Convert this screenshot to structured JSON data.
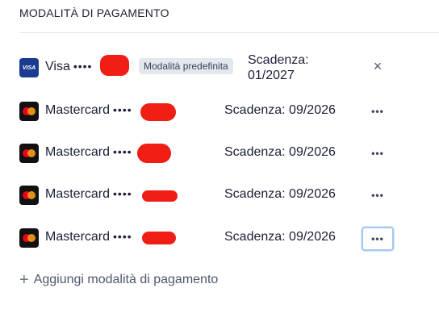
{
  "section": {
    "title": "MODALITÀ DI PAGAMENTO"
  },
  "cards": [
    {
      "brand_icon": "visa-logo-icon",
      "brand_short": "VISA",
      "brand": "Visa",
      "masked": "••••",
      "badge": "Modalità predefinita",
      "expiry": "Scadenza: 01/2027",
      "action_icon": "close-icon",
      "action_glyph": "×"
    },
    {
      "brand_icon": "mastercard-logo-icon",
      "brand": "Mastercard",
      "masked": "••••",
      "expiry": "Scadenza: 09/2026",
      "action_icon": "more-options-icon",
      "action_glyph": "•••"
    },
    {
      "brand_icon": "mastercard-logo-icon",
      "brand": "Mastercard",
      "masked": "••••",
      "expiry": "Scadenza: 09/2026",
      "action_icon": "more-options-icon",
      "action_glyph": "•••"
    },
    {
      "brand_icon": "mastercard-logo-icon",
      "brand": "Mastercard",
      "masked": "••••",
      "expiry": "Scadenza: 09/2026",
      "action_icon": "more-options-icon",
      "action_glyph": "•••"
    },
    {
      "brand_icon": "mastercard-logo-icon",
      "brand": "Mastercard",
      "masked": "••••",
      "expiry": "Scadenza: 09/2026",
      "action_icon": "more-options-icon",
      "action_glyph": "•••"
    }
  ],
  "add_payment": {
    "icon": "plus-icon",
    "glyph": "+",
    "label": "Aggiungi modalità di pagamento"
  },
  "colors": {
    "redaction": "#f01e14",
    "visa": "#1a3b8f",
    "mastercard_red": "#eb001b",
    "mastercard_orange": "#f79e1b",
    "badge_bg": "#e3e8ee",
    "focus_ring": "#a6c8f0"
  }
}
